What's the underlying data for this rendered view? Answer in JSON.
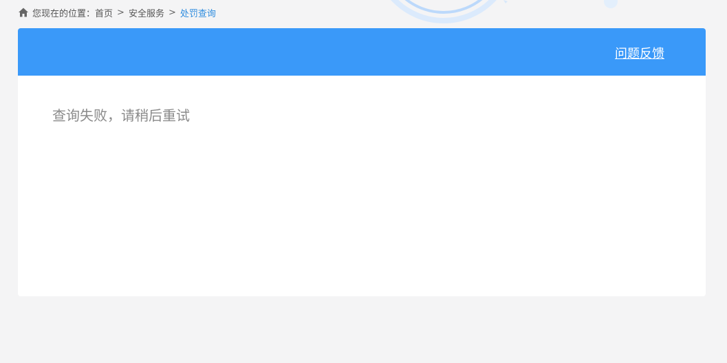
{
  "breadcrumb": {
    "prefix": "您现在的位置：",
    "items": [
      "首页",
      "安全服务"
    ],
    "separator": ">",
    "current": "处罚查询"
  },
  "header": {
    "feedback_label": "问题反馈"
  },
  "main": {
    "message": "查询失败，请稍后重试"
  },
  "colors": {
    "header_bg": "#3a99f9",
    "page_bg": "#f4f4f5",
    "link_current": "#2e8cde"
  },
  "icons": {
    "home": "home-icon"
  }
}
